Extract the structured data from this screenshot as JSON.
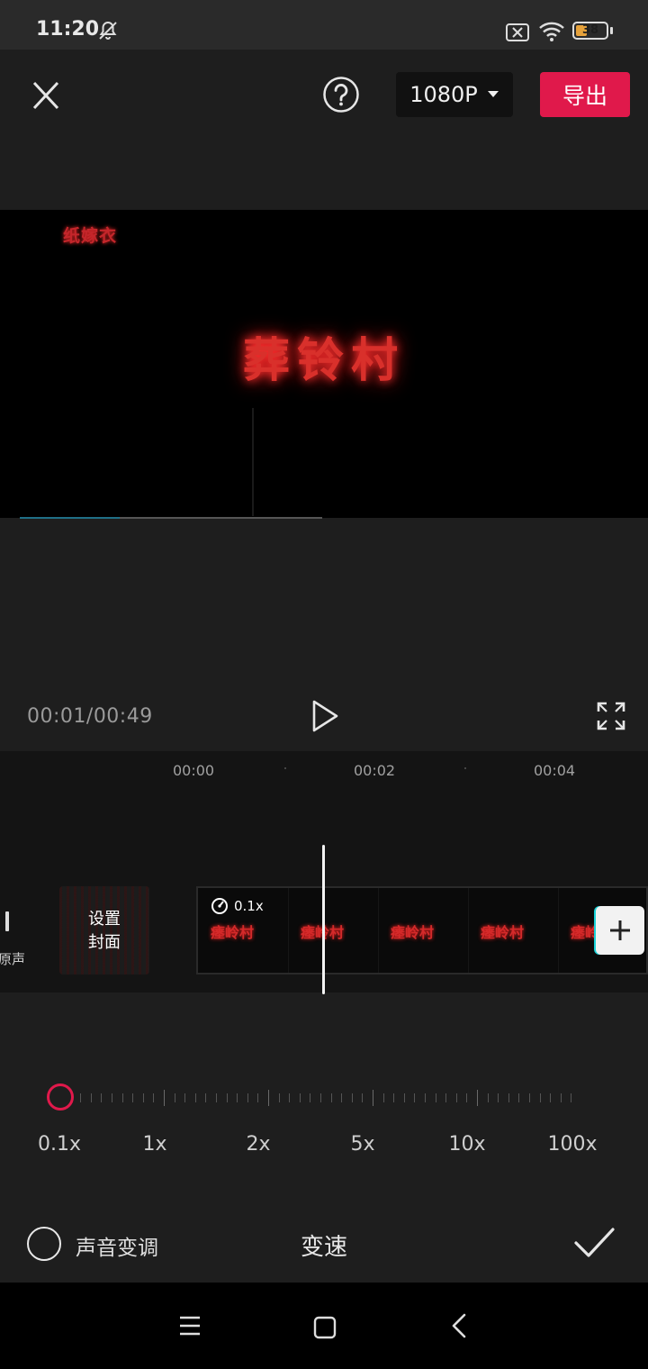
{
  "status_bar": {
    "time": "11:20",
    "battery": "38",
    "battery_level": 0.38
  },
  "toolbar": {
    "resolution": "1080P",
    "export_label": "导出"
  },
  "preview": {
    "logo_text": "纸嫁衣",
    "title_text": "葬铃村",
    "progress": 0.33
  },
  "playback": {
    "time": "00:01/00:49"
  },
  "timeline": {
    "ruler": [
      "00:00",
      "00:02",
      "00:04"
    ],
    "original_audio_label": "原声",
    "cover_label_line1": "设置",
    "cover_label_line2": "封面",
    "speed_badge": "0.1x",
    "frame_texts": [
      "瘗岭村",
      "瘗岭村",
      "瘗岭村",
      "瘗岭村",
      "瘗岭"
    ]
  },
  "speed_slider": {
    "labels": [
      "0.1x",
      "1x",
      "2x",
      "5x",
      "10x",
      "100x"
    ],
    "selected": "0.1x"
  },
  "bottom_bar": {
    "voice_change_label": "声音变调",
    "title": "变速"
  },
  "colors": {
    "accent": "#e0194b",
    "background": "#1e1e1e",
    "timeline_bg": "#141414",
    "cyan_edge": "#19d3d8"
  }
}
